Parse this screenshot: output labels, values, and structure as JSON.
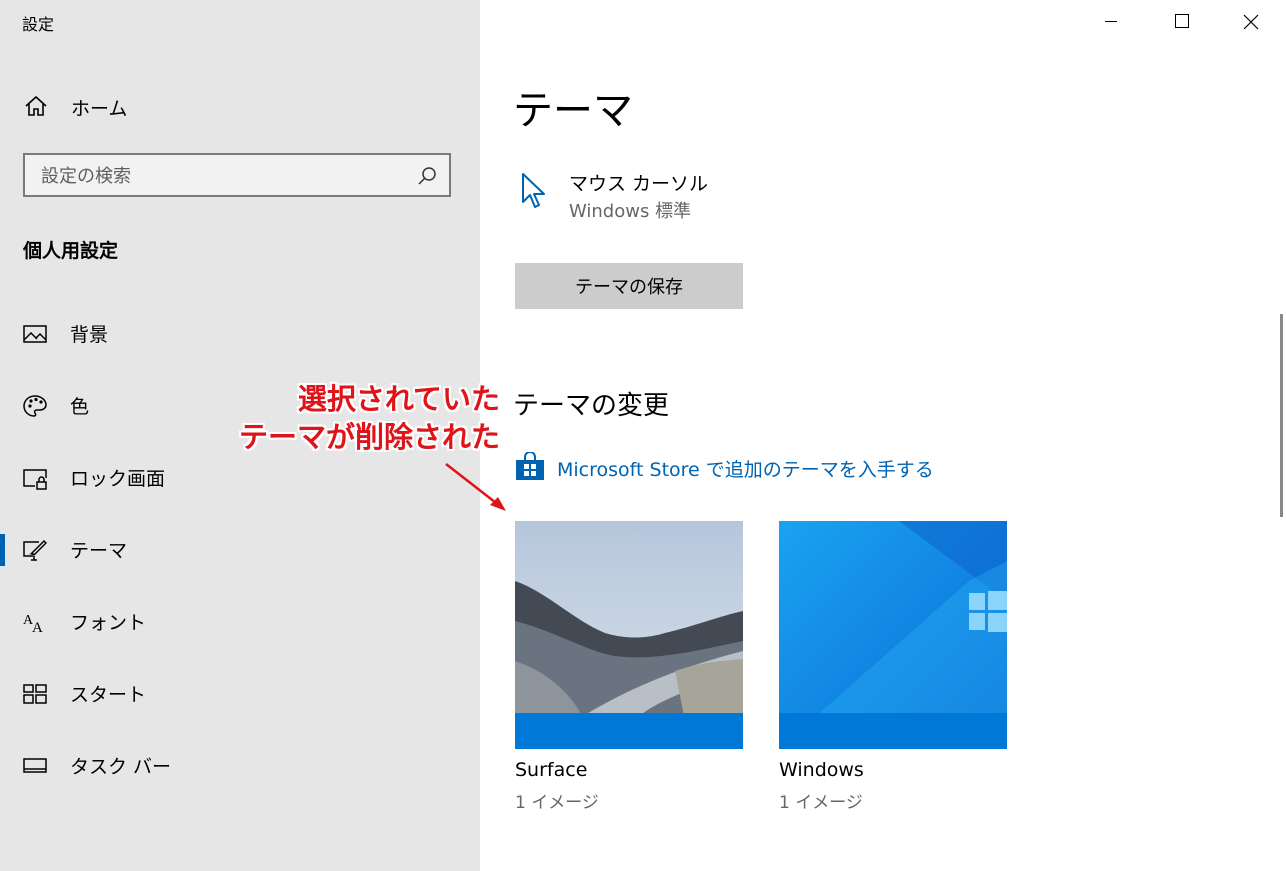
{
  "window": {
    "title": "設定"
  },
  "sidebar": {
    "home_label": "ホーム",
    "search_placeholder": "設定の検索",
    "section_title": "個人用設定",
    "items": [
      {
        "label": "背景",
        "icon": "picture-icon"
      },
      {
        "label": "色",
        "icon": "palette-icon"
      },
      {
        "label": "ロック画面",
        "icon": "lock-screen-icon"
      },
      {
        "label": "テーマ",
        "icon": "theme-icon",
        "selected": true
      },
      {
        "label": "フォント",
        "icon": "font-icon"
      },
      {
        "label": "スタート",
        "icon": "start-icon"
      },
      {
        "label": "タスク バー",
        "icon": "taskbar-icon"
      }
    ]
  },
  "main": {
    "title": "テーマ",
    "cursor": {
      "title": "マウス カーソル",
      "value": "Windows 標準"
    },
    "save_button": "テーマの保存",
    "change_title": "テーマの変更",
    "store_link": "Microsoft Store で追加のテーマを入手する",
    "themes": [
      {
        "name": "Surface",
        "count": "1 イメージ"
      },
      {
        "name": "Windows",
        "count": "1 イメージ"
      }
    ]
  },
  "annotation": {
    "line1": "選択されていた",
    "line2": "テーマが削除された",
    "color": "#e0131a"
  },
  "colors": {
    "accent": "#0063b1",
    "sidebar_bg": "#e6e6e6",
    "tile_bar": "#0078d7"
  }
}
